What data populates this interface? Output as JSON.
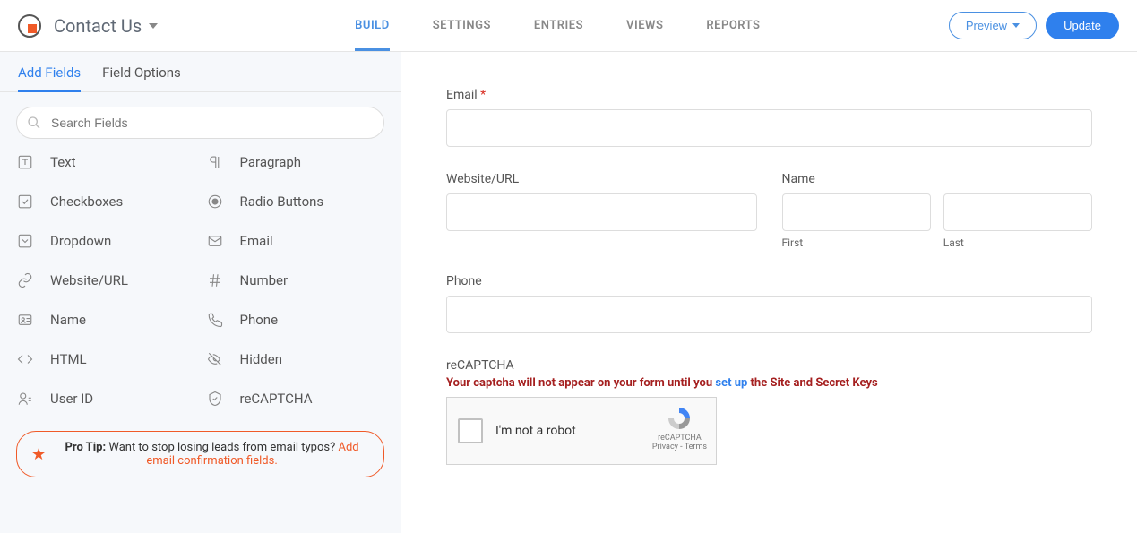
{
  "header": {
    "form_title": "Contact Us",
    "tabs": [
      "BUILD",
      "SETTINGS",
      "ENTRIES",
      "VIEWS",
      "REPORTS"
    ],
    "active_tab": 0,
    "preview_label": "Preview",
    "update_label": "Update"
  },
  "sidebar": {
    "tabs": [
      "Add Fields",
      "Field Options"
    ],
    "active_tab": 0,
    "search_placeholder": "Search Fields",
    "fields": [
      {
        "label": "Text",
        "icon": "text"
      },
      {
        "label": "Paragraph",
        "icon": "paragraph"
      },
      {
        "label": "Checkboxes",
        "icon": "checkbox"
      },
      {
        "label": "Radio Buttons",
        "icon": "radio"
      },
      {
        "label": "Dropdown",
        "icon": "dropdown"
      },
      {
        "label": "Email",
        "icon": "email"
      },
      {
        "label": "Website/URL",
        "icon": "link"
      },
      {
        "label": "Number",
        "icon": "number"
      },
      {
        "label": "Name",
        "icon": "name"
      },
      {
        "label": "Phone",
        "icon": "phone"
      },
      {
        "label": "HTML",
        "icon": "html"
      },
      {
        "label": "Hidden",
        "icon": "hidden"
      },
      {
        "label": "User ID",
        "icon": "user"
      },
      {
        "label": "reCAPTCHA",
        "icon": "shield"
      }
    ],
    "protip": {
      "prefix": "Pro Tip:",
      "body": " Want to stop losing leads from email typos? ",
      "link": "Add email confirmation fields."
    }
  },
  "canvas": {
    "fields": [
      {
        "type": "text",
        "label": "Email",
        "required": true
      },
      {
        "type": "half",
        "left": {
          "label": "Website/URL"
        },
        "right": {
          "label": "Name",
          "sublabels": [
            "First",
            "Last"
          ]
        }
      },
      {
        "type": "text",
        "label": "Phone"
      },
      {
        "type": "recaptcha",
        "label": "reCAPTCHA",
        "warning_pre": "Your captcha will not appear on your form until you ",
        "warning_link": "set up",
        "warning_post": " the Site and Secret Keys",
        "robot_text": "I'm not a robot",
        "badge_title": "reCAPTCHA",
        "badge_sub": "Privacy - Terms"
      }
    ]
  }
}
